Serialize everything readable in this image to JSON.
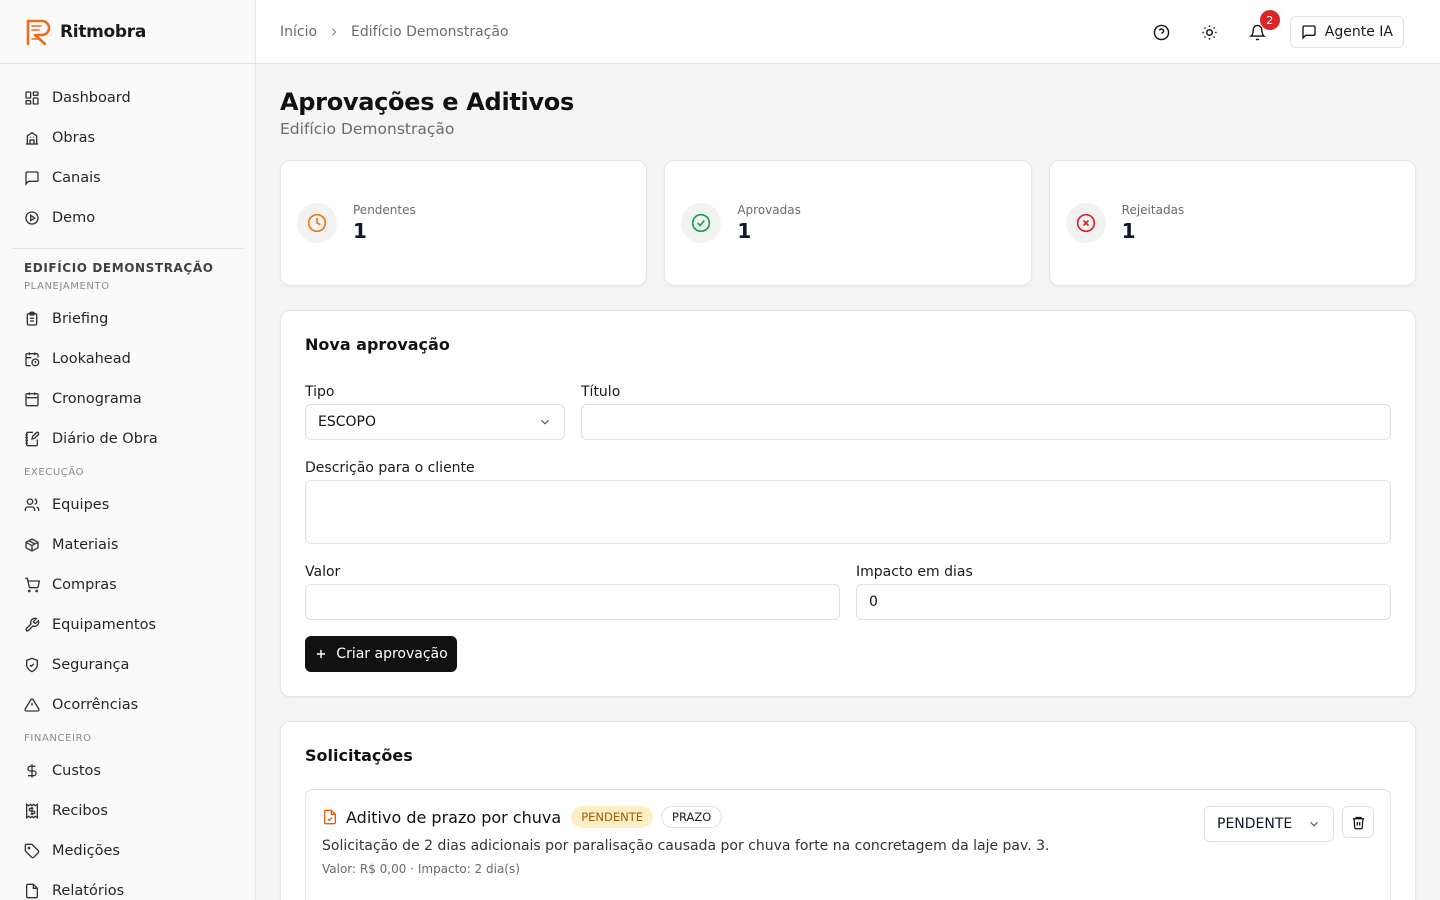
{
  "app": {
    "name": "Ritmobra",
    "brand_color": "#f26b1d"
  },
  "sidebar": {
    "main_items": [
      {
        "label": "Dashboard",
        "icon": "dashboard-icon"
      },
      {
        "label": "Obras",
        "icon": "building-icon"
      },
      {
        "label": "Canais",
        "icon": "chat-icon"
      },
      {
        "label": "Demo",
        "icon": "play-icon"
      }
    ],
    "project": "EDIFÍCIO DEMONSTRAÇÃO",
    "sections": [
      {
        "title": "PLANEJAMENTO",
        "items": [
          {
            "label": "Briefing",
            "icon": "clipboard-icon"
          },
          {
            "label": "Lookahead",
            "icon": "calendar-clock-icon"
          },
          {
            "label": "Cronograma",
            "icon": "calendar-icon"
          },
          {
            "label": "Diário de Obra",
            "icon": "notebook-pen-icon"
          }
        ]
      },
      {
        "title": "EXECUÇÃO",
        "items": [
          {
            "label": "Equipes",
            "icon": "users-icon"
          },
          {
            "label": "Materiais",
            "icon": "package-icon"
          },
          {
            "label": "Compras",
            "icon": "cart-icon"
          },
          {
            "label": "Equipamentos",
            "icon": "wrench-icon"
          },
          {
            "label": "Segurança",
            "icon": "shield-icon"
          },
          {
            "label": "Ocorrências",
            "icon": "alert-triangle-icon"
          }
        ]
      },
      {
        "title": "FINANCEIRO",
        "items": [
          {
            "label": "Custos",
            "icon": "dollar-icon"
          },
          {
            "label": "Recibos",
            "icon": "receipt-icon"
          },
          {
            "label": "Medições",
            "icon": "tag-icon"
          },
          {
            "label": "Relatórios",
            "icon": "file-icon"
          }
        ]
      }
    ]
  },
  "header": {
    "breadcrumb": [
      "Início",
      "Edifício Demonstração"
    ],
    "notifications_count": "2",
    "agent_label": "Agente IA"
  },
  "page": {
    "title": "Aprovações e Aditivos",
    "subtitle": "Edifício Demonstração"
  },
  "stats": [
    {
      "label": "Pendentes",
      "value": "1",
      "color": "#ea7a12",
      "icon": "clock-icon"
    },
    {
      "label": "Aprovadas",
      "value": "1",
      "color": "#16a34a",
      "icon": "check-circle-icon"
    },
    {
      "label": "Rejeitadas",
      "value": "1",
      "color": "#dc2626",
      "icon": "x-circle-icon"
    }
  ],
  "form": {
    "title": "Nova aprovação",
    "tipo_label": "Tipo",
    "tipo_value": "ESCOPO",
    "titulo_label": "Título",
    "titulo_value": "",
    "descricao_label": "Descrição para o cliente",
    "valor_label": "Valor",
    "valor_value": "",
    "impacto_label": "Impacto em dias",
    "impacto_value": "0",
    "submit_label": "Criar aprovação"
  },
  "requests": {
    "title": "Solicitações",
    "items": [
      {
        "title": "Aditivo de prazo por chuva",
        "status_badge": "PENDENTE",
        "type_badge": "PRAZO",
        "description": "Solicitação de 2 dias adicionais por paralisação causada por chuva forte na concretagem da laje pav. 3.",
        "meta": "Valor: R$ 0,00 · Impacto: 2 dia(s)",
        "status_select": "PENDENTE"
      }
    ]
  }
}
